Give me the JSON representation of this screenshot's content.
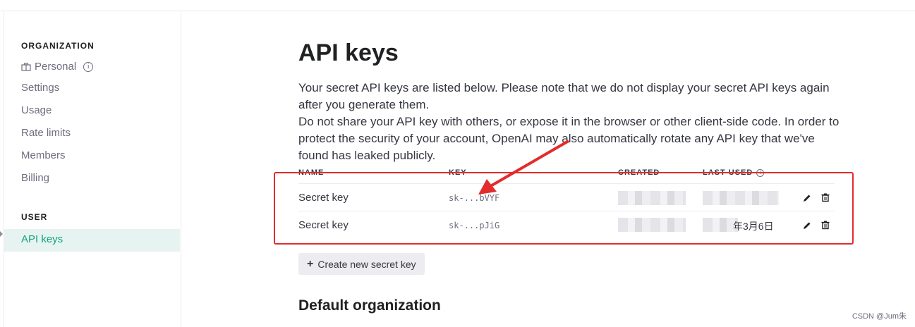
{
  "sidebar": {
    "org_heading": "ORGANIZATION",
    "org_name": "Personal",
    "items": [
      {
        "label": "Settings"
      },
      {
        "label": "Usage"
      },
      {
        "label": "Rate limits"
      },
      {
        "label": "Members"
      },
      {
        "label": "Billing"
      }
    ],
    "user_heading": "USER",
    "active_item": "API keys"
  },
  "page": {
    "title": "API keys",
    "desc_1": "Your secret API keys are listed below. Please note that we do not display your secret API keys again after you generate them.",
    "desc_2": "Do not share your API key with others, or expose it in the browser or other client-side code. In order to protect the security of your account, OpenAI may also automatically rotate any API key that we've found has leaked publicly."
  },
  "table": {
    "columns": [
      "NAME",
      "KEY",
      "CREATED",
      "LAST USED"
    ],
    "rows": [
      {
        "name": "Secret key",
        "key": "sk-...bVYF",
        "last_used": ""
      },
      {
        "name": "Secret key",
        "key": "sk-...pJiG",
        "last_used": "年3月6日"
      }
    ]
  },
  "actions": {
    "create_label": "Create new secret key"
  },
  "section": {
    "default_org_heading": "Default organization"
  },
  "watermark": "CSDN @Jum朱",
  "colors": {
    "accent": "#10a37f",
    "annotation": "#e32c2c"
  }
}
